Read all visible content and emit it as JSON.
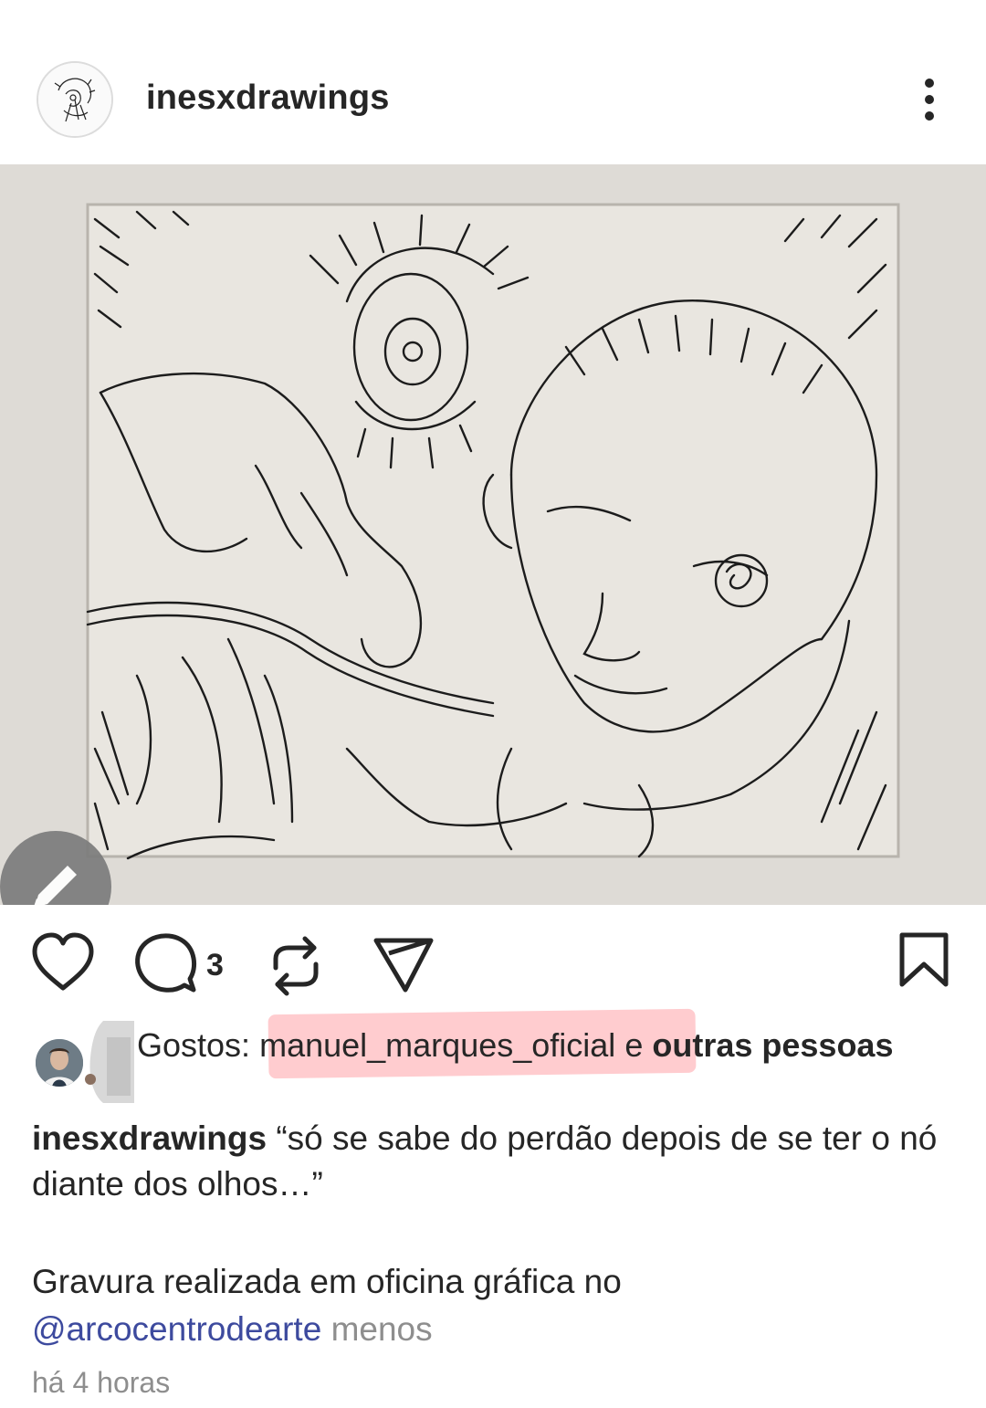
{
  "post": {
    "username": "inesxdrawings",
    "comment_count": "3",
    "likes": {
      "label": "Gostos:",
      "first_liker": "manuel_marques_oficial",
      "connector": "e",
      "others": "outras pessoas"
    },
    "caption": {
      "username": "inesxdrawings",
      "text": "“só se sabe do perdão depois de se ter o nó diante dos olhos…”",
      "line2": "Gravura realizada em oficina gráfica no",
      "mention": "@arcocentrodearte",
      "less": "menos"
    },
    "time": "há 4 horas"
  },
  "icons": {
    "more": "more-vertical-icon",
    "like": "heart-icon",
    "comment": "comment-icon",
    "repost": "repost-icon",
    "share": "send-icon",
    "save": "bookmark-icon",
    "edit": "pencil-icon"
  },
  "colors": {
    "text": "#262626",
    "secondary": "#8e8e8e",
    "mention": "#3d4a9e",
    "highlight": "#ff7882"
  }
}
